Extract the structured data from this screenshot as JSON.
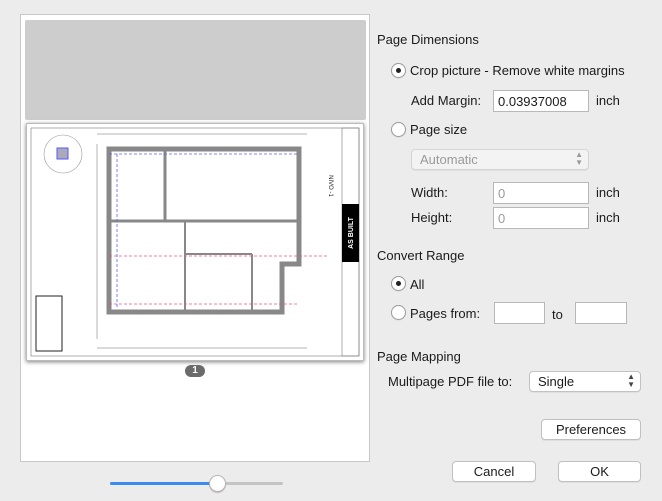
{
  "preview": {
    "page_number": "1",
    "drawing_stamp": "AS BUILT",
    "drawing_title": "NIVO -1",
    "zoom_slider_value": 0.62
  },
  "page_dimensions": {
    "heading": "Page Dimensions",
    "crop_label": "Crop picture - Remove white margins",
    "crop_selected": true,
    "add_margin_label": "Add Margin:",
    "add_margin_value": "0.03937008",
    "unit": "inch",
    "page_size_label": "Page size",
    "page_size_option": "Automatic",
    "width_label": "Width:",
    "width_value": "0",
    "height_label": "Height:",
    "height_value": "0"
  },
  "convert_range": {
    "heading": "Convert Range",
    "all_label": "All",
    "pages_from_label": "Pages from:",
    "to_label": "to",
    "from_value": "",
    "to_value": ""
  },
  "page_mapping": {
    "heading": "Page Mapping",
    "multipage_label": "Multipage PDF file to:",
    "multipage_value": "Single"
  },
  "buttons": {
    "preferences": "Preferences",
    "cancel": "Cancel",
    "ok": "OK"
  },
  "icons": {
    "select_arrows": "⌃⌄"
  }
}
